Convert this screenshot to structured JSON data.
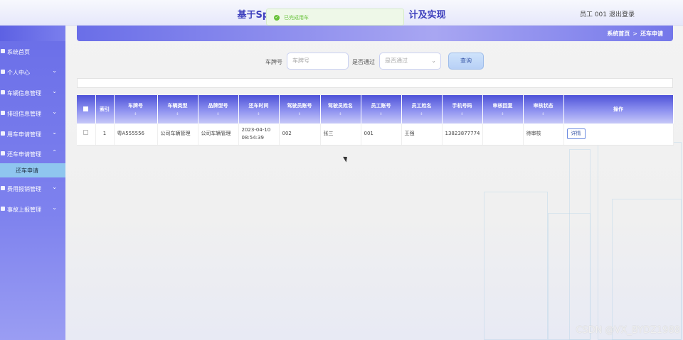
{
  "header": {
    "title": "基于Spr",
    "title_tail": "计及实现",
    "user": "员工 001",
    "logout": "退出登录"
  },
  "toast": {
    "text": "已完成用车"
  },
  "breadcrumb": {
    "home": "系统首页",
    "sep": ">",
    "current": "还车申请"
  },
  "sidebar": {
    "items": [
      {
        "label": "系统首页",
        "expandable": false
      },
      {
        "label": "个人中心",
        "expandable": true
      },
      {
        "label": "车辆信息管理",
        "expandable": true
      },
      {
        "label": "排班信息管理",
        "expandable": true
      },
      {
        "label": "用车申请管理",
        "expandable": true
      },
      {
        "label": "还车申请管理",
        "expandable": true,
        "expanded": true
      },
      {
        "label": "费用报销管理",
        "expandable": true
      },
      {
        "label": "事故上报管理",
        "expandable": true
      }
    ],
    "submenu": {
      "label": "还车申请"
    }
  },
  "search": {
    "plate_label": "车牌号",
    "plate_placeholder": "车牌号",
    "passed_label": "是否通过",
    "passed_placeholder": "是否通过",
    "query_button": "查询"
  },
  "table": {
    "headers": [
      "索引",
      "车牌号",
      "车辆类型",
      "品牌型号",
      "还车时间",
      "驾驶员账号",
      "驾驶员姓名",
      "员工账号",
      "员工姓名",
      "手机号码",
      "审核回复",
      "审核状态",
      "操作"
    ],
    "rows": [
      {
        "index": "1",
        "plate": "粤A555556",
        "type": "公司车辆管理",
        "brand": "公司车辆管理",
        "return_time": "2023-04-10 08:54:39",
        "driver_account": "002",
        "driver_name": "张三",
        "employee_account": "001",
        "employee_name": "王强",
        "phone": "13823877774",
        "review_reply": "",
        "review_status": "待审核",
        "action": "详情"
      }
    ]
  },
  "watermark": "CSDN @VX_BYDZ1988",
  "colors": {
    "accent": "#6a6ee8",
    "toast_green": "#67c23a",
    "header_title": "#3d3fbd"
  }
}
